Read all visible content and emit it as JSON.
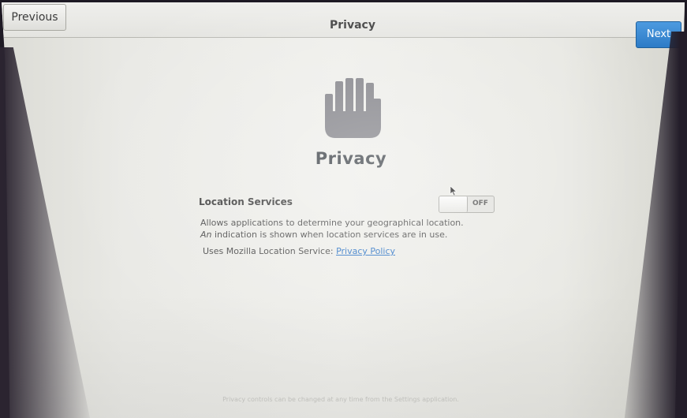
{
  "header": {
    "previous_label": "Previous",
    "title": "Privacy",
    "next_label": "Next"
  },
  "main": {
    "icon": "hand-stop-icon",
    "title": "Privacy",
    "location_services": {
      "label": "Location Services",
      "toggle_state": "OFF",
      "description_part1": "Allows applications to determine your geographical location.",
      "description_part2": "An",
      "description_part3": "indication is shown when location services are in use.",
      "uses_text": "Uses Mozilla Location Service:",
      "privacy_policy_link": "Privacy Policy"
    },
    "footer_note": "Privacy controls can be changed at any time from the Settings application."
  },
  "colors": {
    "accent": "#2c7bc6",
    "link": "#2a72c4",
    "icon": "#7f7f85"
  }
}
